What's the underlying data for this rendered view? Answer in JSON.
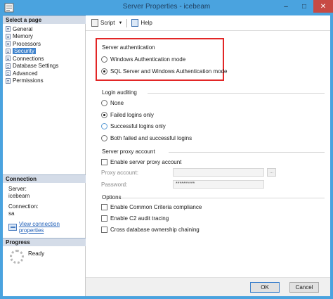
{
  "window": {
    "title": "Server Properties - icebeam",
    "minimize": "–",
    "maximize": "□",
    "close": "✕"
  },
  "left": {
    "select_page_header": "Select a page",
    "pages": [
      {
        "label": "General",
        "selected": false
      },
      {
        "label": "Memory",
        "selected": false
      },
      {
        "label": "Processors",
        "selected": false
      },
      {
        "label": "Security",
        "selected": true
      },
      {
        "label": "Connections",
        "selected": false
      },
      {
        "label": "Database Settings",
        "selected": false
      },
      {
        "label": "Advanced",
        "selected": false
      },
      {
        "label": "Permissions",
        "selected": false
      }
    ],
    "connection_header": "Connection",
    "server_label": "Server:",
    "server_value": "icebeam",
    "connection_label": "Connection:",
    "connection_value": "sa",
    "view_link": "View connection properties",
    "progress_header": "Progress",
    "progress_status": "Ready"
  },
  "toolbar": {
    "script_label": "Script",
    "help_label": "Help"
  },
  "server_auth": {
    "title": "Server authentication",
    "options": [
      {
        "label": "Windows Authentication mode",
        "checked": false
      },
      {
        "label": "SQL Server and Windows Authentication mode",
        "checked": true
      }
    ]
  },
  "login_auditing": {
    "title": "Login auditing",
    "options": [
      {
        "label": "None",
        "checked": false
      },
      {
        "label": "Failed logins only",
        "checked": true
      },
      {
        "label": "Successful logins only",
        "checked": false
      },
      {
        "label": "Both failed and successful logins",
        "checked": false
      }
    ]
  },
  "proxy": {
    "title": "Server proxy account",
    "enable_label": "Enable server proxy account",
    "proxy_account_label": "Proxy account:",
    "proxy_account_value": "",
    "password_label": "Password:",
    "password_value": "**********",
    "ellipsis": "..."
  },
  "options": {
    "title": "Options",
    "items": [
      {
        "label": "Enable Common Criteria compliance",
        "checked": false
      },
      {
        "label": "Enable C2 audit tracing",
        "checked": false
      },
      {
        "label": "Cross database ownership chaining",
        "checked": false
      }
    ]
  },
  "footer": {
    "ok_label": "OK",
    "cancel_label": "Cancel"
  },
  "colors": {
    "window_frame": "#4aa3df",
    "selection": "#3e82cc",
    "highlight_box": "#e22626"
  }
}
